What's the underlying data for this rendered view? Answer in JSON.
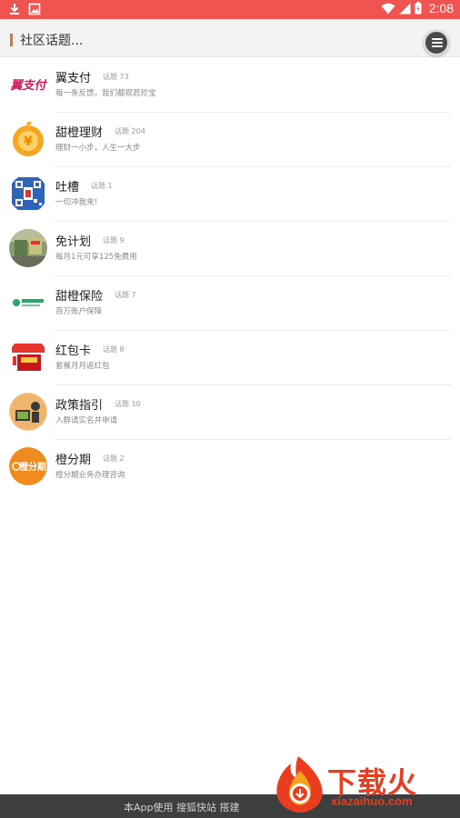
{
  "status_bar": {
    "time": "2:08",
    "icons": [
      "download-icon",
      "image-icon",
      "wifi-icon",
      "signal-icon",
      "battery-icon"
    ],
    "color": "#ef5451"
  },
  "header": {
    "title": "社区话题...",
    "accent_color": "#ef6b3a",
    "menu_icon": "menu-icon"
  },
  "topics": [
    {
      "name": "翼支付",
      "count": "话题 73",
      "desc": "每一条反馈，我们都视若珍宝",
      "logo": "yizhifu-logo"
    },
    {
      "name": "甜橙理财",
      "count": "话题 204",
      "desc": "理财一小步，人生一大步",
      "logo": "tiancheng-licai-logo"
    },
    {
      "name": "吐槽",
      "count": "话题 1",
      "desc": "一切冲我来！",
      "logo": "tucao-logo"
    },
    {
      "name": "免计划",
      "count": "话题 9",
      "desc": "每月1元可享125免费用",
      "logo": "mianjihua-logo"
    },
    {
      "name": "甜橙保险",
      "count": "话题 7",
      "desc": "百万账户保障",
      "logo": "tiancheng-baoxian-logo"
    },
    {
      "name": "红包卡",
      "count": "话题 8",
      "desc": "套餐月月返红包",
      "logo": "hongbaoka-logo"
    },
    {
      "name": "政策指引",
      "count": "话题 10",
      "desc": "入群请实名并申请",
      "logo": "zhengce-logo"
    },
    {
      "name": "橙分期",
      "count": "话题 2",
      "desc": "橙分期业务办理咨询",
      "logo": "chengfenqi-logo"
    }
  ],
  "footer": {
    "text": "本App使用 搜狐快站 搭建"
  },
  "watermark": {
    "title": "下载火",
    "subtitle": "xiazaihuo.com",
    "color": "#e83d1f"
  }
}
